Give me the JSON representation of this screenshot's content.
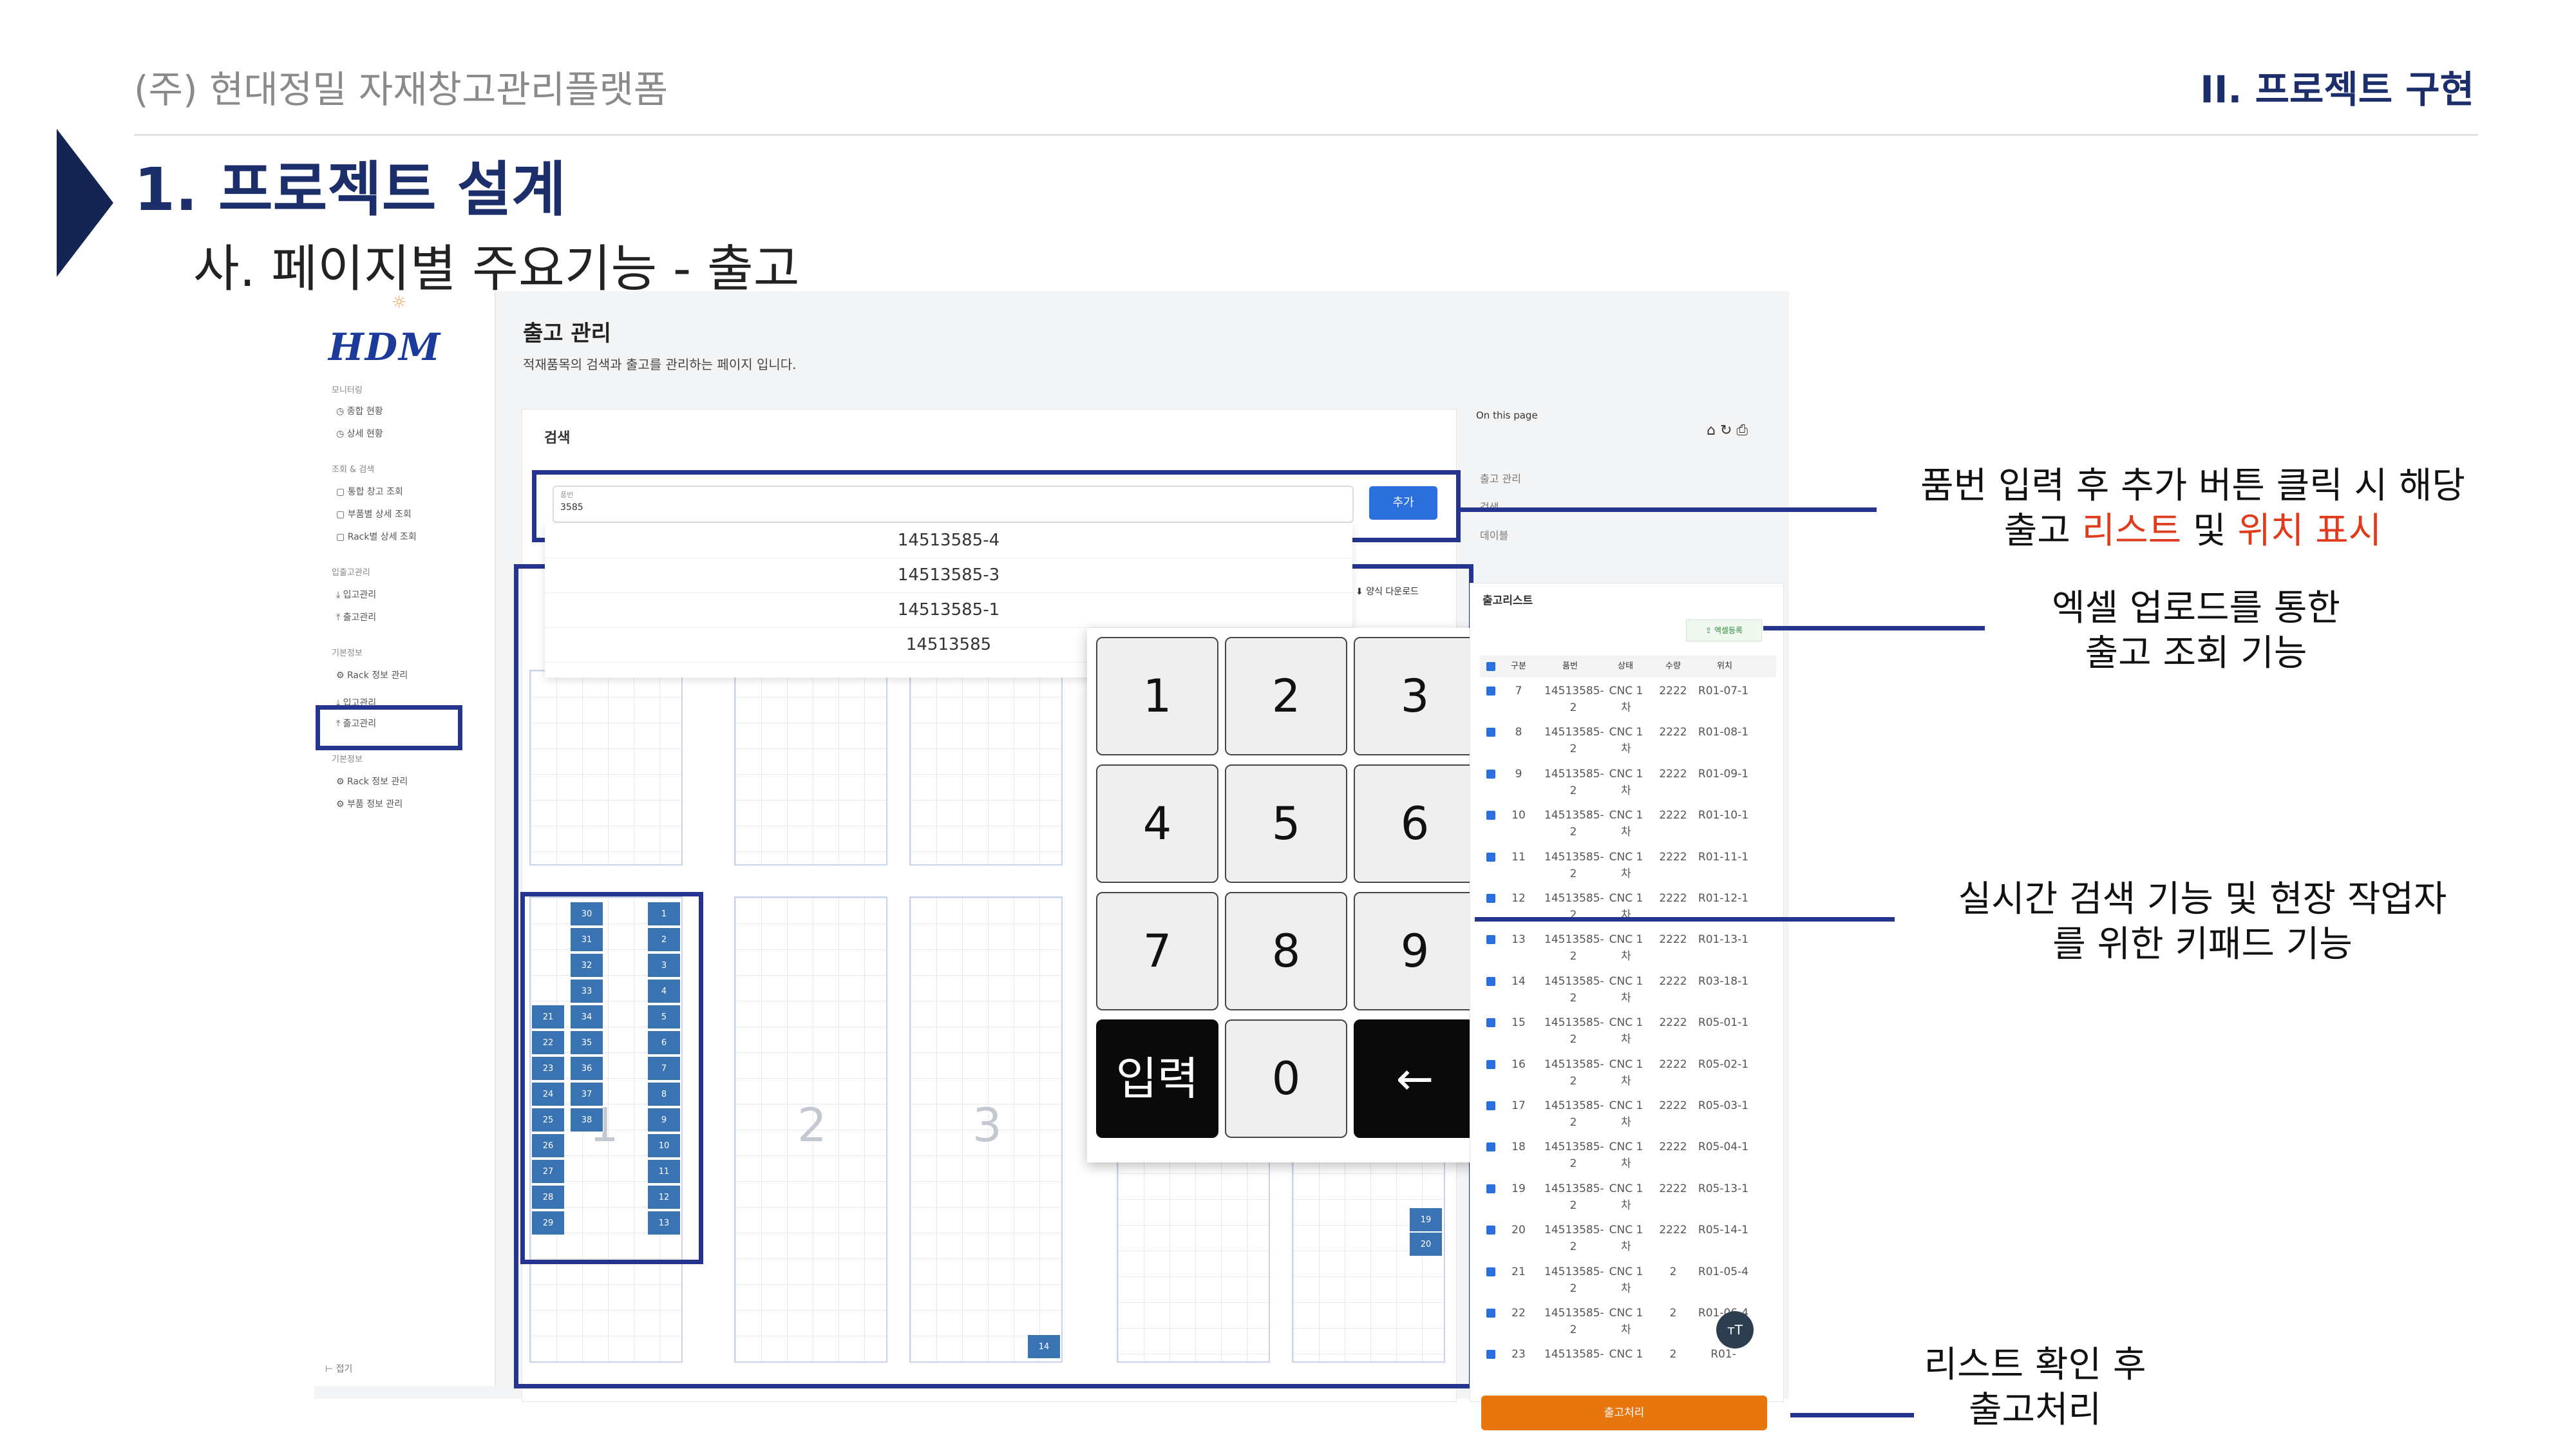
{
  "slide": {
    "company": "(주) 현대정밀 자재창고관리플랫폼",
    "section": "II. 프로젝트 구현",
    "title": "1. 프로젝트 설계",
    "subtitle": "사. 페이지별 주요기능 - 출고"
  },
  "app": {
    "logo": "HDM",
    "sidebar": {
      "groups": [
        {
          "label": "모니터링",
          "items": [
            "종합 현황",
            "상세 현황"
          ]
        },
        {
          "label": "조회 & 검색",
          "items": [
            "통합 창고 조회",
            "부품별 상세 조회",
            "Rack별 상세 조회"
          ]
        },
        {
          "label": "입출고관리",
          "items": [
            "입고관리",
            "출고관리"
          ]
        },
        {
          "label": "기본정보",
          "items": [
            "Rack 정보 관리",
            "입고관리",
            "출고관리"
          ]
        },
        {
          "label": "기본정보",
          "items": [
            "Rack 정보 관리",
            "부품 정보 관리"
          ]
        }
      ],
      "footer": "접기"
    },
    "page_title": "출고 관리",
    "page_desc": "적재품목의 검색과 출고를 관리하는 페이지 입니다.",
    "search": {
      "title": "검색",
      "input_label": "품번",
      "input_value": "3585",
      "add_label": "추가",
      "suggestions": [
        "14513585-4",
        "14513585-3",
        "14513585-1",
        "14513585"
      ],
      "excel_download": "양식 다운로드"
    },
    "racks": {
      "labels": [
        "1",
        "2",
        "3"
      ],
      "rack1_left": [
        "21",
        "22",
        "23",
        "24",
        "25",
        "26",
        "27",
        "28",
        "29"
      ],
      "rack1_mid": [
        "30",
        "31",
        "32",
        "33",
        "34",
        "35",
        "36",
        "37",
        "38"
      ],
      "rack1_right": [
        "1",
        "2",
        "3",
        "4",
        "5",
        "6",
        "7",
        "8",
        "9",
        "10",
        "11",
        "12",
        "13"
      ],
      "rack3_bottom": "14",
      "rack5_cells": [
        "19",
        "20"
      ]
    },
    "keypad": {
      "keys": [
        "1",
        "2",
        "3",
        "4",
        "5",
        "6",
        "7",
        "8",
        "9",
        "입력",
        "0",
        "←"
      ]
    },
    "onpage": {
      "title": "On this page",
      "links": [
        "출고 관리",
        "검색",
        "데이블"
      ]
    },
    "ship_list": {
      "title": "출고리스트",
      "excel_upload": "엑셀등록",
      "columns": [
        "구분",
        "품번",
        "상태",
        "수량",
        "위치"
      ],
      "rows": [
        {
          "no": "7",
          "part": "14513585-2",
          "status": "CNC 1차",
          "qty": "2222",
          "loc": "R01-07-1"
        },
        {
          "no": "8",
          "part": "14513585-2",
          "status": "CNC 1차",
          "qty": "2222",
          "loc": "R01-08-1"
        },
        {
          "no": "9",
          "part": "14513585-2",
          "status": "CNC 1차",
          "qty": "2222",
          "loc": "R01-09-1"
        },
        {
          "no": "10",
          "part": "14513585-2",
          "status": "CNC 1차",
          "qty": "2222",
          "loc": "R01-10-1"
        },
        {
          "no": "11",
          "part": "14513585-2",
          "status": "CNC 1차",
          "qty": "2222",
          "loc": "R01-11-1"
        },
        {
          "no": "12",
          "part": "14513585-2",
          "status": "CNC 1차",
          "qty": "2222",
          "loc": "R01-12-1"
        },
        {
          "no": "13",
          "part": "14513585-2",
          "status": "CNC 1차",
          "qty": "2222",
          "loc": "R01-13-1"
        },
        {
          "no": "14",
          "part": "14513585-2",
          "status": "CNC 1차",
          "qty": "2222",
          "loc": "R03-18-1"
        },
        {
          "no": "15",
          "part": "14513585-2",
          "status": "CNC 1차",
          "qty": "2222",
          "loc": "R05-01-1"
        },
        {
          "no": "16",
          "part": "14513585-2",
          "status": "CNC 1차",
          "qty": "2222",
          "loc": "R05-02-1"
        },
        {
          "no": "17",
          "part": "14513585-2",
          "status": "CNC 1차",
          "qty": "2222",
          "loc": "R05-03-1"
        },
        {
          "no": "18",
          "part": "14513585-2",
          "status": "CNC 1차",
          "qty": "2222",
          "loc": "R05-04-1"
        },
        {
          "no": "19",
          "part": "14513585-2",
          "status": "CNC 1차",
          "qty": "2222",
          "loc": "R05-13-1"
        },
        {
          "no": "20",
          "part": "14513585-2",
          "status": "CNC 1차",
          "qty": "2222",
          "loc": "R05-14-1"
        },
        {
          "no": "21",
          "part": "14513585-2",
          "status": "CNC 1차",
          "qty": "2",
          "loc": "R01-05-4"
        },
        {
          "no": "22",
          "part": "14513585-2",
          "status": "CNC 1차",
          "qty": "2",
          "loc": "R01-06-4"
        },
        {
          "no": "23",
          "part": "14513585-",
          "status": "CNC 1",
          "qty": "2",
          "loc": "R01-"
        }
      ],
      "ship_button": "출고처리"
    }
  },
  "annotations": {
    "note1_a": "품번 입력 후 추가 버튼 클릭 시 해당",
    "note1_b1": "출고 ",
    "note1_red1": "리스트",
    "note1_b2": " 및 ",
    "note1_red2": "위치 표시",
    "note2": [
      "엑셀 업로드를 통한",
      "출고 조회 기능"
    ],
    "note3": [
      "실시간 검색 기능 및 현장 작업자",
      "를 위한 키패드 기능"
    ],
    "note4": [
      "리스트 확인 후",
      "출고처리"
    ]
  },
  "colors": {
    "navy": "#24348f",
    "accent": "#e03b1c",
    "ship": "#e8760f",
    "cell": "#3a73b3"
  }
}
